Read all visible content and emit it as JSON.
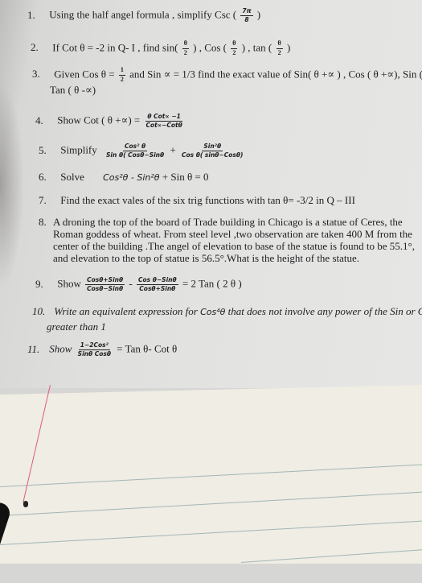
{
  "document": {
    "type": "printed trigonometry worksheet photo",
    "questions": [
      {
        "number": "1.",
        "text": "Using the half angel formula , simplify Csc (",
        "frac": {
          "num": "7π",
          "den": "8"
        },
        "after": ")"
      },
      {
        "number": "2.",
        "text": "If Cot θ = -2 in Q- I , find sin(",
        "frac1": {
          "num": "θ",
          "den": "2"
        },
        "mid1": ") , Cos (",
        "frac2": {
          "num": "θ",
          "den": "2"
        },
        "mid2": ") , tan (",
        "frac3": {
          "num": "θ",
          "den": "2"
        },
        "after": ")"
      },
      {
        "number": "3.",
        "text": "Given Cos θ =",
        "frac": {
          "num": "1",
          "den": "2"
        },
        "after": "and Sin ∝ = 1/3  find the exact value of Sin( θ +∝ ) , Cos ( θ +∝), Sin (( θ -∝) ,",
        "line2": "Tan ( θ -∝)"
      },
      {
        "number": "4.",
        "text": "Show Cot ( θ +∝) =",
        "frac": {
          "num": "θ Cot∝ −1",
          "den": "Cot∝−Cotθ"
        }
      },
      {
        "number": "5.",
        "text": "Simplify",
        "frac1": {
          "num": "Cos² θ",
          "den": "Sin θ( Cosθ−Sinθ"
        },
        "op": "+",
        "frac2": {
          "num": "Sin²θ",
          "den": "Cos θ( sinθ−Cosθ)"
        }
      },
      {
        "number": "6.",
        "text": "Solve",
        "expr_italic": "Cos²θ - Sin²θ",
        "after": "+ Sin θ = 0"
      },
      {
        "number": "7.",
        "text": "Find the exact vales of the six trig functions with tan θ= -3/2 in Q – III"
      },
      {
        "number": "8.",
        "text": "A droning the top of the board of Trade building in Chicago is a statue of Ceres, the Roman goddess of wheat. From steel level ,two observation are taken 400  M from the center  of the building .The angel of elevation to base of the statue is found to be 55.1°, and elevation to the top of statue is 56.5°.What is the height of the statue."
      },
      {
        "number": "9.",
        "text": "Show",
        "frac1": {
          "num": "Cosθ+Sinθ",
          "den": "Cosθ−Sinθ"
        },
        "op": "-",
        "frac2": {
          "num": "Cos θ−Sinθ",
          "den": "Cosθ+Sinθ"
        },
        "after": "= 2 Tan ( 2 θ )"
      },
      {
        "number": "10.",
        "text": "Write an equivalent expression for",
        "expr_italic": "Cos⁴θ",
        "after": "that does not involve any power of the Sin or Cos",
        "line2": "greater than 1"
      },
      {
        "number": "11.",
        "text": "Show",
        "frac": {
          "num": "1−2Cos²",
          "den": "Sinθ Cosθ"
        },
        "after": "= Tan θ- Cot θ"
      }
    ]
  },
  "colors": {
    "paper": "#e3e3e1",
    "notepad": "#efede4",
    "rule_line": "#8aa3a8",
    "margin_line": "#e05b7a",
    "ink": "#1e1e22"
  }
}
